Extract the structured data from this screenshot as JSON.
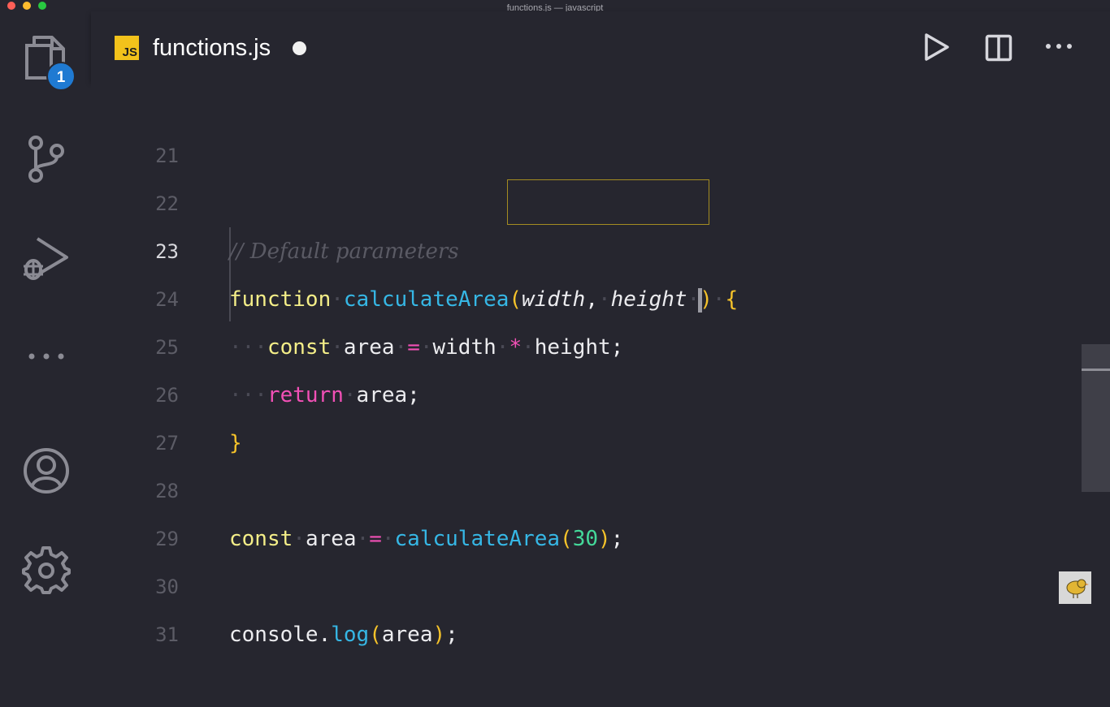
{
  "window": {
    "title": "functions.js — javascript"
  },
  "activity_bar": {
    "explorer_badge": "1",
    "items": [
      "explorer-icon",
      "source-control-icon",
      "run-debug-icon",
      "more-icon",
      "account-icon",
      "settings-icon"
    ]
  },
  "tab": {
    "language_icon": "JS",
    "file_name": "functions.js",
    "unsaved": true
  },
  "toolbar": {
    "run": "play-icon",
    "split": "split-editor-icon",
    "more": "ellipsis-icon"
  },
  "editor": {
    "active_line": "23",
    "lines": [
      {
        "number": "21"
      },
      {
        "number": "22",
        "comment": "// Default parameters"
      },
      {
        "number": "23",
        "kw": "function",
        "fn": "calculateArea",
        "open": "(",
        "p1": "width",
        "comma": ",",
        "p2": "height",
        "close": ")",
        "brace": "{"
      },
      {
        "number": "24",
        "kw": "const",
        "name": "area",
        "eq": "=",
        "a": "width",
        "mul": "*",
        "b": "height",
        "semi": ";"
      },
      {
        "number": "25",
        "kw": "return",
        "name": "area",
        "semi": ";"
      },
      {
        "number": "26",
        "brace": "}"
      },
      {
        "number": "27"
      },
      {
        "number": "28",
        "kw": "const",
        "name": "area",
        "eq": "=",
        "fn": "calculateArea",
        "open": "(",
        "arg": "30",
        "close": ")",
        "semi": ";"
      },
      {
        "number": "29"
      },
      {
        "number": "30",
        "obj": "console",
        "dot": ".",
        "method": "log",
        "open": "(",
        "arg": "area",
        "close": ")",
        "semi": ";"
      },
      {
        "number": "31"
      }
    ]
  },
  "colors": {
    "background": "#26262f",
    "keyword": "#f4ee88",
    "function": "#36b7e5",
    "operator": "#f250b6",
    "number": "#44d99a",
    "brace": "#f6c32a",
    "badge": "#1f7ad2"
  }
}
